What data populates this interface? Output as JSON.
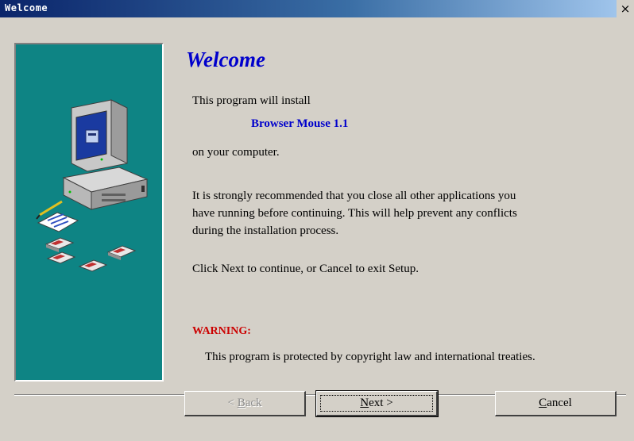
{
  "window": {
    "title": "Welcome",
    "close_glyph": "×"
  },
  "content": {
    "heading": "Welcome",
    "install_line": "This program will install",
    "product_name": "Browser Mouse 1.1",
    "on_computer_line": "on your computer.",
    "recommend_lines": [
      "It is strongly recommended that you close all other applications you",
      "have running before continuing. This will help prevent any conflicts",
      "during the installation process."
    ],
    "instruction_line": "Click Next to continue, or Cancel to exit Setup.",
    "warning_label": "WARNING:",
    "copyright_text": "This program is protected by copyright law and international treaties."
  },
  "buttons": {
    "back": {
      "accel": "B",
      "prefix": "< ",
      "rest": "ack",
      "enabled": false
    },
    "next": {
      "accel": "N",
      "prefix": "",
      "rest": "ext >",
      "default": true
    },
    "cancel": {
      "accel": "C",
      "prefix": "",
      "rest": "ancel"
    }
  },
  "illustration": {
    "description_icons": [
      "computer-icon",
      "floppy-disk-icon",
      "document-icon"
    ],
    "panel_color": "#0e8484"
  },
  "colors": {
    "accent_blue": "#0000cc",
    "warning_red": "#cc0000",
    "titlebar_start": "#0a246a",
    "titlebar_end": "#a6caf0"
  }
}
